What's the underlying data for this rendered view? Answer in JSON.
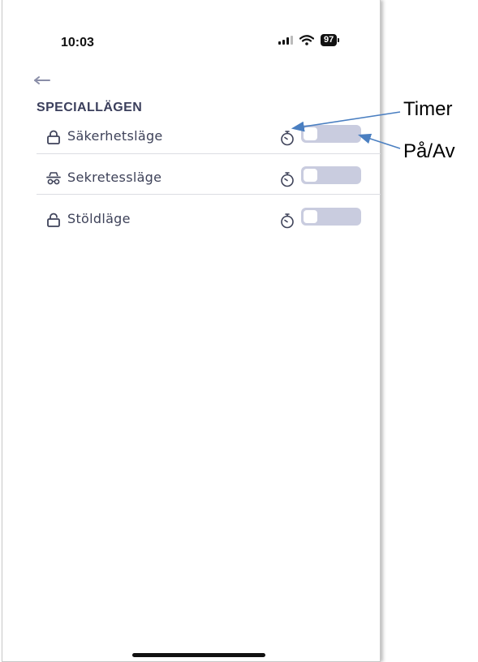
{
  "status": {
    "time": "10:03",
    "battery": "97"
  },
  "header": {
    "back_icon": "arrow-left-icon"
  },
  "section": {
    "title": "SPECIALLÄGEN"
  },
  "rows": [
    {
      "label": "Säkerhetsläge",
      "icon": "lock-icon",
      "toggle_on": false
    },
    {
      "label": "Sekretessläge",
      "icon": "incognito-icon",
      "toggle_on": false
    },
    {
      "label": "Stöldläge",
      "icon": "unlock-icon",
      "toggle_on": false
    }
  ],
  "annotations": {
    "timer": "Timer",
    "onoff": "På/Av"
  },
  "colors": {
    "toggle_off": "#c9ccdf",
    "arrow": "#4a7fc1",
    "text": "#3e4259"
  }
}
